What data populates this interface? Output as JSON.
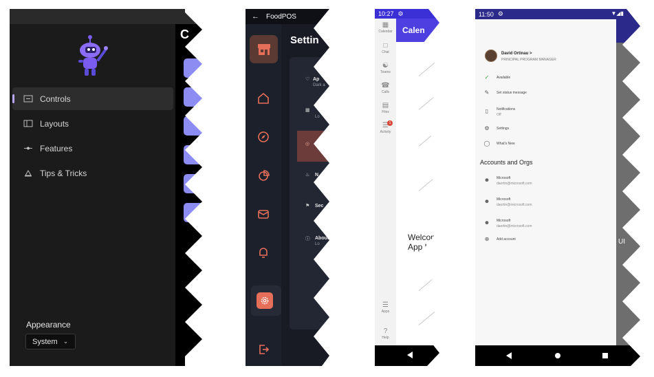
{
  "panel1": {
    "nav_items": [
      {
        "label": "Controls",
        "icon": "controls-icon",
        "selected": true
      },
      {
        "label": "Layouts",
        "icon": "layouts-icon",
        "selected": false
      },
      {
        "label": "Features",
        "icon": "features-icon",
        "selected": false
      },
      {
        "label": "Tips & Tricks",
        "icon": "tips-icon",
        "selected": false
      }
    ],
    "content_title_fragment": "C",
    "appearance_label": "Appearance",
    "appearance_value": "System",
    "accent_color": "#8c8cf2"
  },
  "panel2": {
    "app_title": "FoodPOS",
    "page_title": "Settin",
    "rows": [
      {
        "title": "Ap",
        "subtitle": "Dark a"
      },
      {
        "title": "",
        "subtitle": "Lo"
      },
      {
        "title": "",
        "subtitle": ""
      },
      {
        "title": "N",
        "subtitle": ""
      },
      {
        "title": "Sec",
        "subtitle": ""
      },
      {
        "title": "About",
        "subtitle": "Lo"
      }
    ],
    "accent_color": "#e66f5a"
  },
  "panel3": {
    "time": "10:27",
    "header_title": "Calen",
    "rail_items": [
      "Calendar",
      "Chat",
      "Teams",
      "Calls",
      "Files",
      "Activity",
      "Apps",
      "Help"
    ],
    "activity_badge": "1",
    "welcome_line1": "Welcome",
    "welcome_line2": "App UI",
    "accent_color": "#4d3fe0"
  },
  "panel4": {
    "time": "11:50",
    "user_name": "David Ortinau >",
    "user_role": "PRINCIPAL PROGRAM MANAGER",
    "menu": [
      {
        "label": "Available",
        "sub": ""
      },
      {
        "label": "Set status message",
        "sub": ""
      },
      {
        "label": "Notifications",
        "sub": "Off"
      },
      {
        "label": "Settings",
        "sub": ""
      },
      {
        "label": "What's New",
        "sub": ""
      }
    ],
    "section_title": "Accounts and Orgs",
    "accounts": [
      {
        "org": "Microsoft",
        "email": "daortin@microsoft.com"
      },
      {
        "org": "Microsoft",
        "email": "daortin@microsoft.com"
      },
      {
        "org": "Microsoft",
        "email": "daortin@microsoft.com"
      }
    ],
    "add_account": "Add account",
    "background_text": "UI"
  }
}
